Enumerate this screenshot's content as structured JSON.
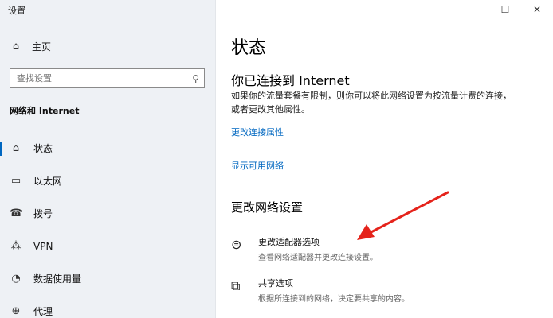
{
  "window": {
    "title": "设置",
    "minimize_glyph": "—",
    "maximize_glyph": "☐",
    "close_glyph": "✕"
  },
  "sidebar": {
    "home_label": "主页",
    "home_icon": "home-icon",
    "search_placeholder": "查找设置",
    "section_title": "网络和 Internet",
    "items": [
      {
        "label": "状态",
        "icon": "status-icon",
        "glyph": "⌂",
        "active": true
      },
      {
        "label": "以太网",
        "icon": "ethernet-icon",
        "glyph": "▭"
      },
      {
        "label": "拨号",
        "icon": "dialup-icon",
        "glyph": "☎"
      },
      {
        "label": "VPN",
        "icon": "vpn-icon",
        "glyph": "⁂"
      },
      {
        "label": "数据使用量",
        "icon": "data-usage-icon",
        "glyph": "◔"
      },
      {
        "label": "代理",
        "icon": "proxy-icon",
        "glyph": "⊕"
      }
    ]
  },
  "main": {
    "page_title": "状态",
    "status_heading": "你已连接到 Internet",
    "status_description": "如果你的流量套餐有限制，则你可以将此网络设置为按流量计费的连接，或者更改其他属性。",
    "link_change_properties": "更改连接属性",
    "link_show_networks": "显示可用网络",
    "change_settings_heading": "更改网络设置",
    "options": [
      {
        "title": "更改适配器选项",
        "subtitle": "查看网络适配器并更改连接设置。",
        "icon": "adapter-icon",
        "glyph": "⊜"
      },
      {
        "title": "共享选项",
        "subtitle": "根据所连接到的网络，决定要共享的内容。",
        "icon": "sharing-icon",
        "glyph": "⧉"
      }
    ]
  },
  "colors": {
    "accent": "#0067c0",
    "arrow": "#e5231b",
    "sidebar_bg": "#eef1f5"
  }
}
